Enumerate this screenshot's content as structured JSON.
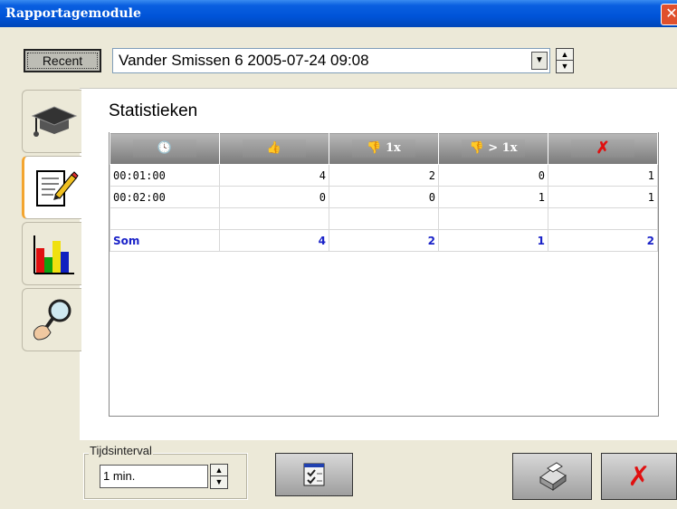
{
  "window": {
    "title": "Rapportagemodule",
    "close_label": "✕"
  },
  "toolbar": {
    "recent_label": "Recent",
    "session_value": "Vander Smissen 6 2005-07-24 09:08"
  },
  "tabs": [
    {
      "name": "graduation-cap",
      "active": false
    },
    {
      "name": "notepad-pencil",
      "active": true
    },
    {
      "name": "bar-chart",
      "active": false
    },
    {
      "name": "magnifier-hand",
      "active": false
    }
  ],
  "stats": {
    "heading": "Statistieken",
    "columns": [
      {
        "icon": "clock-icon",
        "label": ""
      },
      {
        "icon": "thumbs-up-icon",
        "label": ""
      },
      {
        "icon": "thumbs-down-icon",
        "label": "1x"
      },
      {
        "icon": "thumbs-down-icon",
        "label": "> 1x"
      },
      {
        "icon": "red-x-icon",
        "label": ""
      }
    ],
    "rows": [
      [
        "00:01:00",
        "4",
        "2",
        "0",
        "1"
      ],
      [
        "00:02:00",
        "0",
        "0",
        "1",
        "1"
      ],
      [
        "",
        "",
        "",
        "",
        ""
      ]
    ],
    "sum": [
      "Som",
      "4",
      "2",
      "1",
      "2"
    ]
  },
  "footer": {
    "interval_label": "Tijdsinterval",
    "interval_value": "1 min.",
    "checklist_icon": "checklist-icon",
    "print_icon": "printer-icon",
    "close_icon": "red-x-icon"
  },
  "colors": {
    "sum_text": "#1a22c8",
    "accent_tab": "#f3a530",
    "titlebar": "#0054d8"
  }
}
